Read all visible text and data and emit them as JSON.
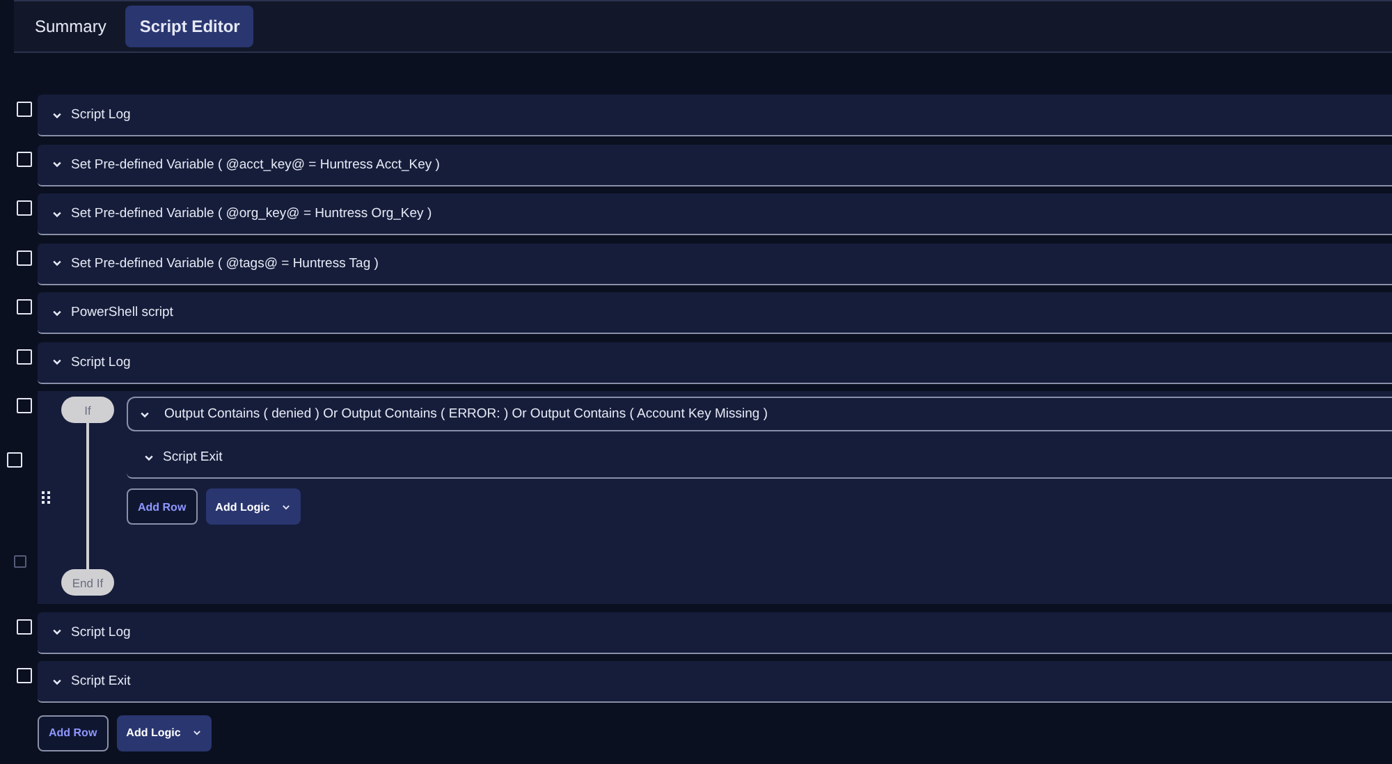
{
  "tabs": [
    {
      "label": "Summary",
      "selected": false
    },
    {
      "label": "Script Editor",
      "selected": true
    }
  ],
  "steps": [
    {
      "kind": "step",
      "label": "Script Log",
      "checked": false
    },
    {
      "kind": "step",
      "label": "Set Pre-defined Variable ( @acct_key@ = Huntress Acct_Key )",
      "checked": false
    },
    {
      "kind": "step",
      "label": "Set Pre-defined Variable ( @org_key@ = Huntress Org_Key )",
      "checked": false
    },
    {
      "kind": "step",
      "label": "Set Pre-defined Variable ( @tags@ = Huntress Tag )",
      "checked": false
    },
    {
      "kind": "step",
      "label": "PowerShell script",
      "checked": false
    },
    {
      "kind": "step",
      "label": "Script Log",
      "checked": false
    },
    {
      "kind": "if",
      "checked": false,
      "start_label": "If",
      "end_label": "End If",
      "end_checked": false,
      "condition": "Output Contains ( denied ) Or Output Contains ( ERROR: ) Or Output Contains ( Account Key Missing )",
      "children": [
        {
          "label": "Script Exit",
          "checked": false
        }
      ],
      "add_row": "Add Row",
      "add_logic": "Add Logic"
    },
    {
      "kind": "step",
      "label": "Script Log",
      "checked": false
    },
    {
      "kind": "step",
      "label": "Script Exit",
      "checked": false
    }
  ],
  "add_row": "Add Row",
  "add_logic": "Add Logic"
}
